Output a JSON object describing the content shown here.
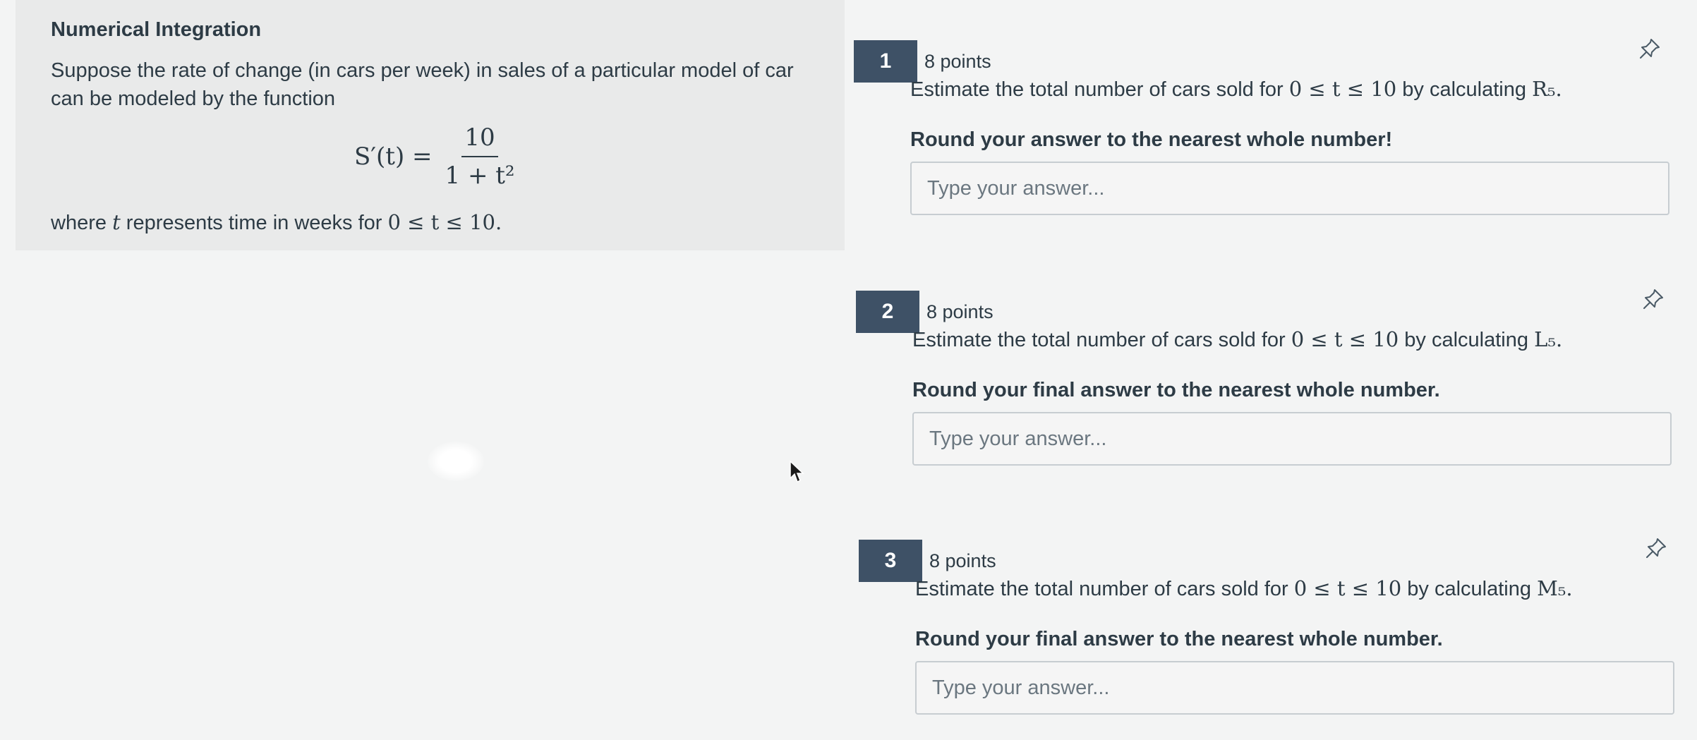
{
  "section_title": "Numerical Integration",
  "intro": {
    "line1": "Suppose the rate of change (in cars per week) in sales of a particular model of car",
    "line2": "can be modeled by the function",
    "formula_lhs": "S′(t) =",
    "formula_num": "10",
    "formula_den": "1 + t²",
    "where_prefix": "where",
    "where_var": "t",
    "where_suffix": "represents time in weeks for",
    "where_range": "0 ≤ t ≤ 10."
  },
  "questions": [
    {
      "number": "1",
      "points": "8 points",
      "prompt_prefix": "Estimate the total number of cars sold for",
      "prompt_range": "0 ≤ t ≤ 10",
      "prompt_middle": "by calculating",
      "prompt_method": "R₅.",
      "instruction": "Round your answer to the nearest whole number!",
      "placeholder": "Type your answer..."
    },
    {
      "number": "2",
      "points": "8 points",
      "prompt_prefix": "Estimate the total number of cars sold for",
      "prompt_range": "0 ≤ t ≤ 10",
      "prompt_middle": "by calculating",
      "prompt_method": "L₅.",
      "instruction": "Round your final answer to the nearest whole number.",
      "placeholder": "Type your answer..."
    },
    {
      "number": "3",
      "points": "8 points",
      "prompt_prefix": "Estimate the total number of cars sold for",
      "prompt_range": "0 ≤ t ≤ 10",
      "prompt_middle": "by calculating",
      "prompt_method": "M₅.",
      "instruction": "Round your final answer to the nearest whole number.",
      "placeholder": "Type your answer..."
    }
  ],
  "icons": {
    "pin": "pin-icon",
    "cursor": "mouse-cursor-icon"
  },
  "colors": {
    "number_badge": "#3e5166",
    "text": "#2d3b45",
    "panel": "#e9eaea"
  }
}
